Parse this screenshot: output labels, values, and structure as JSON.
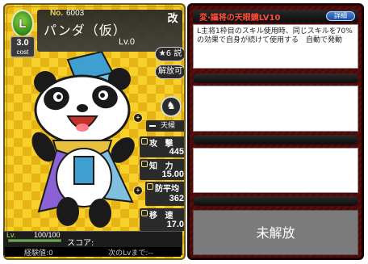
{
  "card": {
    "leader_mark": "L",
    "cost_value": "3.0",
    "cost_label": "cost",
    "no_label": "No.",
    "no_value": "6003",
    "name": "パンダ（仮）",
    "level": "Lv.0",
    "type_kanji": "改",
    "buttons": {
      "stars_label": "★6 説",
      "unlock_label": "解放可"
    },
    "skill_chip": "天候",
    "stats": [
      {
        "label": "攻 撃",
        "value": "445"
      },
      {
        "label": "知 力",
        "value": "15.00"
      },
      {
        "label": "防平均",
        "value": "362"
      },
      {
        "label": "移 速",
        "value": "17.0"
      }
    ],
    "gauge_label": "Lv.",
    "gauge_nums": "100/100",
    "gauge_fraction": 1.0,
    "score_label": "スコア:",
    "exp_label": "経験値:0",
    "next_lv_label": "次のLvまで:--"
  },
  "skill_panel": {
    "title": "変·謳将の天眼鏡LV10",
    "detail_label": "詳細",
    "description": "L主将1枠目のスキル使用時、同じスキルを70%の効果で自身が続けて使用する　自動で発動",
    "locked_label": "未解放"
  },
  "colors": {
    "gold_light": "#f7d02a",
    "gold_dark": "#e6b414",
    "panel_red": "#5d0c0c",
    "title_red": "#ff4a35",
    "detail_blue": "#1f4d9e"
  }
}
